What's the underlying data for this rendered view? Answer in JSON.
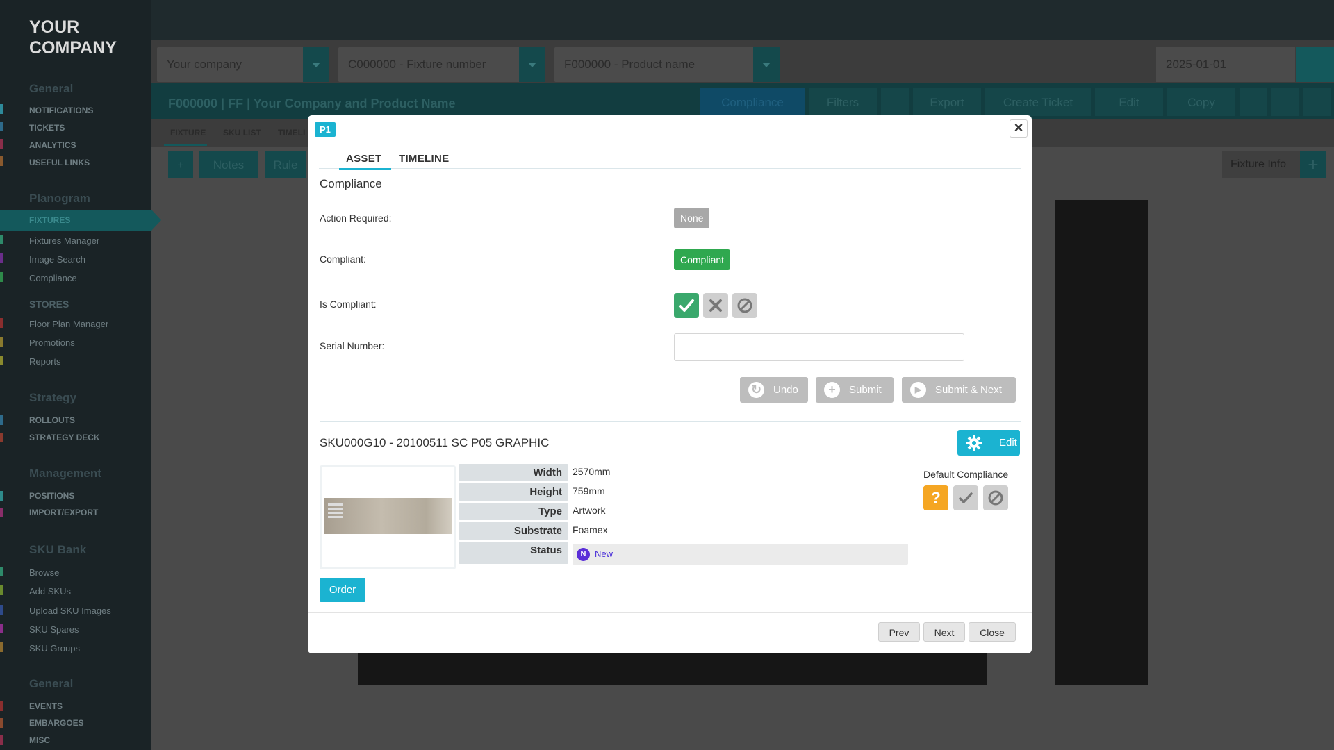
{
  "sidebar": {
    "logo": "YOUR\nCOMPANY",
    "sections": [
      {
        "title": "General",
        "items": [
          "NOTIFICATIONS",
          "TICKETS",
          "ANALYTICS",
          "USEFUL LINKS"
        ]
      },
      {
        "title": "Planogram",
        "items": [
          "FIXTURES",
          "Fixtures Manager",
          "Image Search",
          "Compliance"
        ]
      },
      {
        "title": "STORES",
        "items": [
          "Floor Plan Manager",
          "Promotions",
          "Reports"
        ]
      },
      {
        "title": "Strategy",
        "items": [
          "ROLLOUTS",
          "STRATEGY DECK"
        ]
      },
      {
        "title": "Management",
        "items": [
          "POSITIONS",
          "IMPORT/EXPORT"
        ]
      },
      {
        "title": "SKU Bank",
        "items": [
          "Browse",
          "Add SKUs",
          "Upload SKU Images",
          "SKU Spares",
          "SKU Groups"
        ]
      },
      {
        "title": "General",
        "items": [
          "EVENTS",
          "EMBARGOES",
          "MISC"
        ]
      }
    ],
    "active_item": "FIXTURES"
  },
  "selectors": {
    "company": "Your company",
    "fixture": "C000000 - Fixture number",
    "product": "F000000 - Product name",
    "date": "2025-01-01"
  },
  "titlebar": {
    "title": "F000000 | FF | Your Company and Product Name",
    "buttons": [
      "Compliance",
      "Filters",
      "Export",
      "Create Ticket",
      "Edit",
      "Copy"
    ]
  },
  "bg_tabs": [
    "FIXTURE",
    "SKU LIST",
    "TIMELI"
  ],
  "bg_toolbar": {
    "notes": "Notes",
    "rules": "Rule",
    "fixture_info": "Fixture Info"
  },
  "modal": {
    "badge": "P1",
    "tabs": [
      "ASSET",
      "TIMELINE"
    ],
    "section_title": "Compliance",
    "labels": {
      "action_required": "Action Required:",
      "compliant": "Compliant:",
      "is_compliant": "Is Compliant:",
      "serial_number": "Serial Number:"
    },
    "action_required_value": "None",
    "compliant_value": "Compliant",
    "serial_number_value": "",
    "buttons": {
      "undo": "Undo",
      "submit": "Submit",
      "submit_next": "Submit & Next"
    },
    "sku": {
      "title": "SKU000G10 - 20100511 SC P05 GRAPHIC",
      "edit": "Edit",
      "attributes": [
        {
          "label": "Width",
          "value": "2570mm"
        },
        {
          "label": "Height",
          "value": "759mm"
        },
        {
          "label": "Type",
          "value": "Artwork"
        },
        {
          "label": "Substrate",
          "value": "Foamex"
        },
        {
          "label": "Status",
          "value": "New"
        }
      ],
      "status_badge": "N",
      "default_compliance_label": "Default Compliance",
      "order": "Order"
    },
    "footer": {
      "prev": "Prev",
      "next": "Next",
      "close": "Close"
    },
    "colors": {
      "accent": "#1bb3d1",
      "compliant": "#2fa84f",
      "ok_check": "#3aa86c",
      "question": "#f5a623",
      "status": "#5b2fd8"
    }
  }
}
